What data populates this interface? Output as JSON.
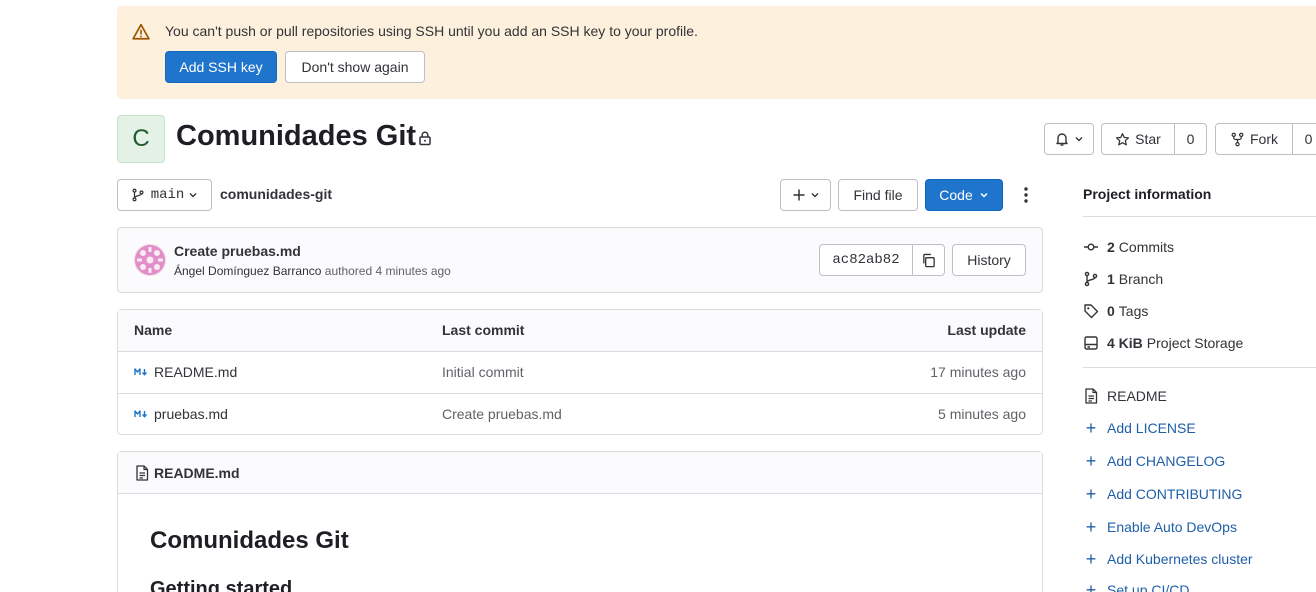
{
  "banner": {
    "message": "You can't push or pull repositories using SSH until you add an SSH key to your profile.",
    "primary_label": "Add SSH key",
    "secondary_label": "Don't show again",
    "icon": "warning-icon"
  },
  "project": {
    "avatar_letter": "C",
    "name": "Comunidades Git",
    "visibility_icon": "lock-icon"
  },
  "actions": {
    "star_label": "Star",
    "star_count": "0",
    "fork_label": "Fork",
    "fork_count": "0"
  },
  "toolbar": {
    "branch": "main",
    "breadcrumb": "comunidades-git",
    "find_file_label": "Find file",
    "code_label": "Code"
  },
  "last_commit": {
    "title": "Create pruebas.md",
    "author": "Ángel Domínguez Barranco",
    "authored_text": "authored 4 minutes ago",
    "sha": "ac82ab82",
    "history_label": "History"
  },
  "file_table": {
    "headers": {
      "name": "Name",
      "last_commit": "Last commit",
      "last_update": "Last update"
    },
    "rows": [
      {
        "name": "README.md",
        "commit": "Initial commit",
        "updated": "17 minutes ago"
      },
      {
        "name": "pruebas.md",
        "commit": "Create pruebas.md",
        "updated": "5 minutes ago"
      }
    ]
  },
  "readme": {
    "filename": "README.md",
    "h1": "Comunidades Git",
    "h2": "Getting started"
  },
  "sidebar": {
    "title": "Project information",
    "stats": [
      {
        "count": "2",
        "label": "Commits",
        "icon": "commit-icon"
      },
      {
        "count": "1",
        "label": "Branch",
        "icon": "branch-icon"
      },
      {
        "count": "0",
        "label": "Tags",
        "icon": "tag-icon"
      },
      {
        "count": "4 KiB",
        "label": "Project Storage",
        "icon": "storage-icon"
      }
    ],
    "links": [
      {
        "label": "README",
        "icon": "document-icon"
      },
      {
        "label": "Add LICENSE",
        "icon": "plus-icon"
      },
      {
        "label": "Add CHANGELOG",
        "icon": "plus-icon"
      },
      {
        "label": "Add CONTRIBUTING",
        "icon": "plus-icon"
      },
      {
        "label": "Enable Auto DevOps",
        "icon": "plus-icon"
      },
      {
        "label": "Add Kubernetes cluster",
        "icon": "plus-icon"
      },
      {
        "label": "Set up CI/CD",
        "icon": "plus-icon"
      }
    ]
  },
  "colors": {
    "primary": "#1f75cb",
    "banner_bg": "#fdf1dd",
    "link": "#1f5fa8"
  }
}
